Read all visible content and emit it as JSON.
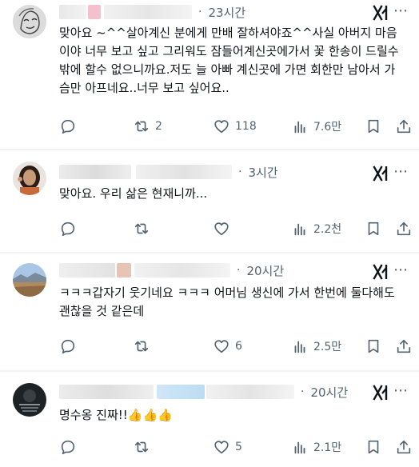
{
  "replies": [
    {
      "time": "23시간",
      "text": "맞아요 ~^^살아계신 분에게 만배 잘하셔야죠^^사실 아버지 마음이야 너무 보고 싶고 그리워도 잠들어계신곳에가서  꽃 한송이 드릴수 밖에 할수 없으니까요.저도 늘 아빠 계신곳에 가면 회한만 남아서 가슴만 아프네요..너무 보고 싶어요..",
      "replies_count": "",
      "reposts": "2",
      "likes": "118",
      "views": "7.6만"
    },
    {
      "time": "3시간",
      "text": "맞아요. 우리 삶은 현재니까...",
      "replies_count": "",
      "reposts": "",
      "likes": "",
      "views": "2.2천"
    },
    {
      "time": "20시간",
      "text": "ㅋㅋㅋ갑자기 웃기네요 ㅋㅋㅋ 어머님 생신에 가서 한번에 둘다해도 괜찮을 것 같은데",
      "replies_count": "",
      "reposts": "",
      "likes": "6",
      "views": "2.5만"
    },
    {
      "time": "20시간",
      "text": "명수옹 진짜!!👍👍👍",
      "replies_count": "",
      "reposts": "",
      "likes": "5",
      "views": "2.1만"
    }
  ],
  "icons": {
    "reply": "speech-bubble-icon",
    "repost": "repost-arrows-icon",
    "like": "heart-icon",
    "views": "bar-chart-icon",
    "bookmark": "bookmark-icon",
    "share": "share-upload-icon",
    "grok": "grok-xai-icon"
  },
  "colors": {
    "text": "#0f1419",
    "muted": "#536471",
    "divider": "#eff3f4"
  }
}
